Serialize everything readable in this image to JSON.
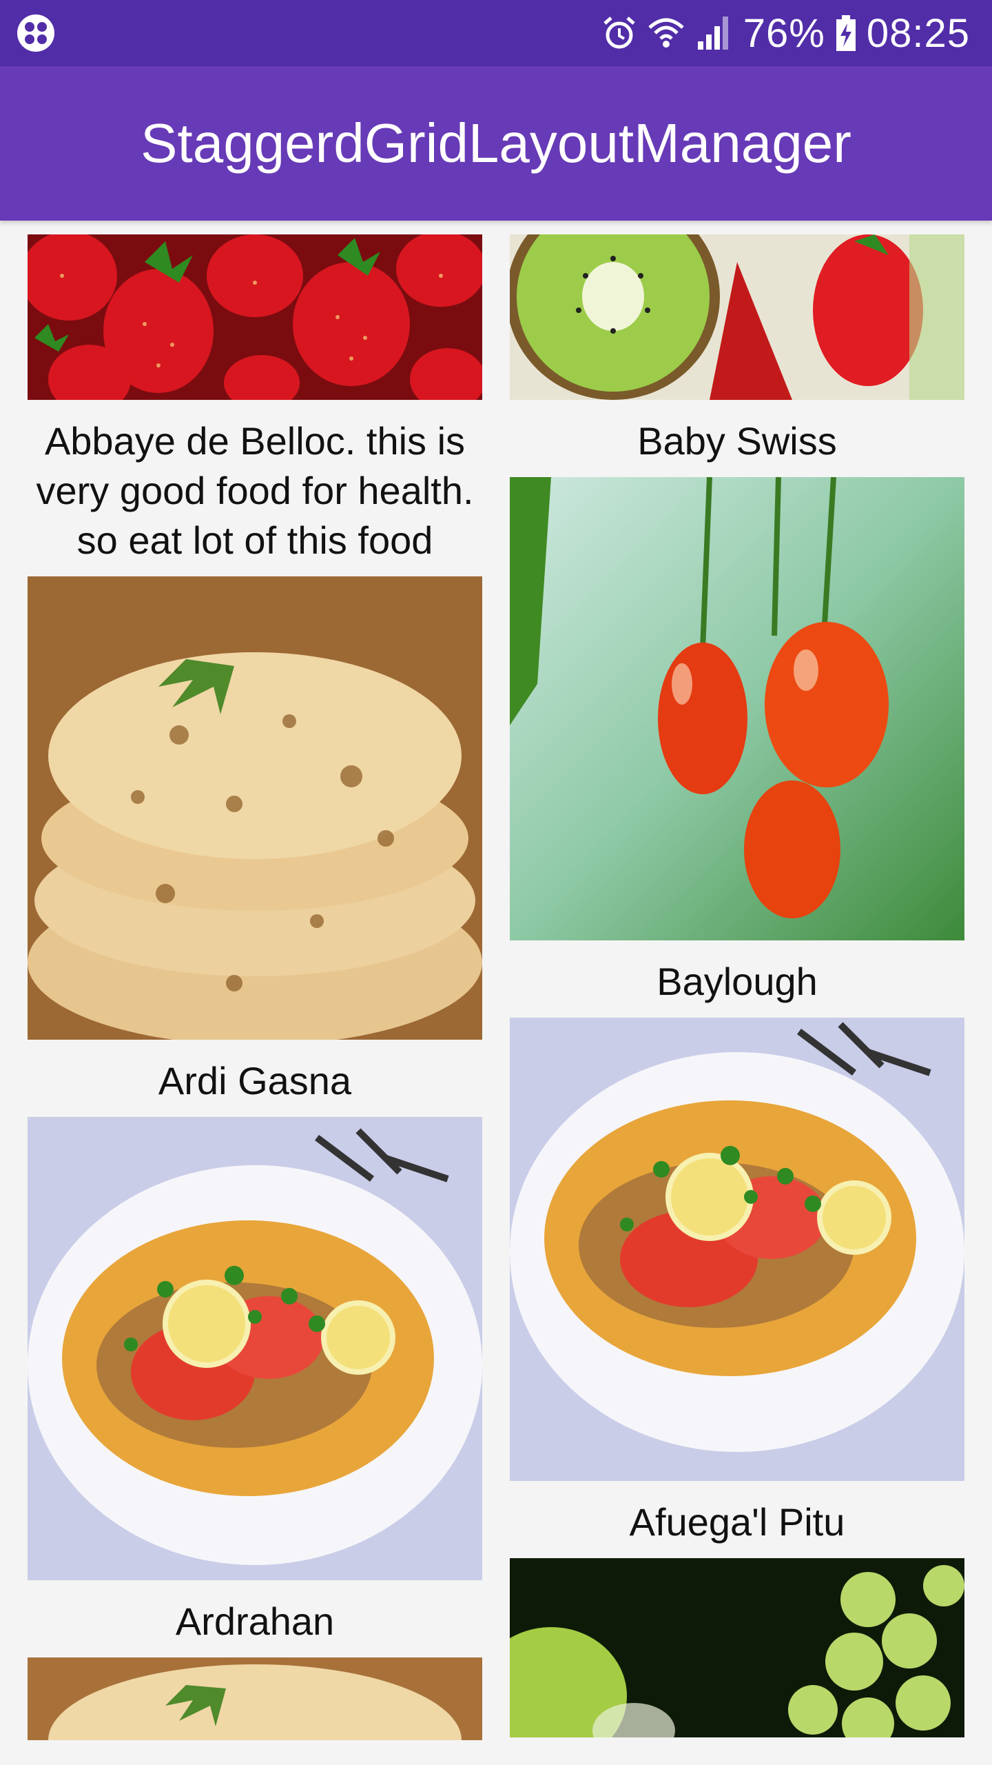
{
  "status_bar": {
    "battery": "76%",
    "time": "08:25",
    "icons": [
      "app-icon",
      "alarm-icon",
      "wifi-icon",
      "signal-icon",
      "battery-charging-icon"
    ]
  },
  "app_bar": {
    "title": "StaggerdGridLayoutManager"
  },
  "grid": {
    "left": [
      {
        "image": "strawberries-image",
        "caption": "Abbaye de Belloc. this is very good food for health. so eat lot of this food"
      },
      {
        "image": "naan-bread-image",
        "caption": "Ardi Gasna"
      },
      {
        "image": "fish-dish-image",
        "caption": "Ardrahan"
      },
      {
        "image": "naan-bread-image",
        "caption": ""
      }
    ],
    "right": [
      {
        "image": "kiwi-strawberry-image",
        "caption": "Baby Swiss"
      },
      {
        "image": "cherries-image",
        "caption": "Baylough"
      },
      {
        "image": "fish-dish-image",
        "caption": "Afuega'l Pitu"
      },
      {
        "image": "grapes-image",
        "caption": ""
      }
    ]
  },
  "colors": {
    "status_bar": "#512da8",
    "app_bar": "#673ab7",
    "background": "#f4f4f4"
  }
}
